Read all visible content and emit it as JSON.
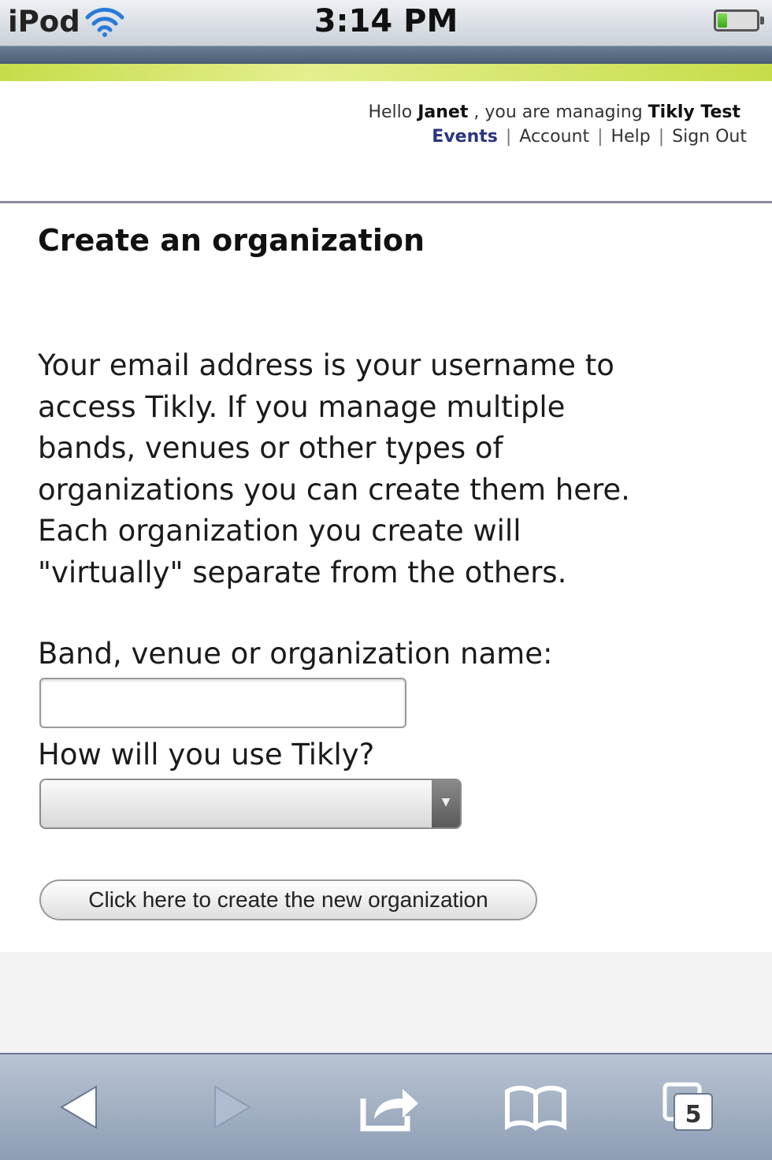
{
  "status_bar": {
    "carrier": "iPod",
    "time": "3:14 PM"
  },
  "header": {
    "greeting_prefix": "Hello",
    "user_name": "Janet",
    "greeting_middle": ", you are managing",
    "org_name": "Tikly Test",
    "nav": [
      {
        "label": "Events",
        "active": true
      },
      {
        "label": "Account",
        "active": false
      },
      {
        "label": "Help",
        "active": false
      },
      {
        "label": "Sign Out",
        "active": false
      }
    ],
    "separator": "|"
  },
  "main": {
    "title": "Create an organization",
    "intro_lines": [
      "Your email address is your username to",
      "access Tikly. If you manage multiple",
      "bands, venues or other types of",
      "organizations you can create them here.",
      "Each organization you create will",
      "\"virtually\" separate from the others."
    ],
    "name_label": "Band, venue or organization name:",
    "name_value": "",
    "usage_label": "How will you use Tikly?",
    "usage_selected": "",
    "submit_label": "Click here to create the new organization"
  },
  "toolbar": {
    "tabs_count": "5",
    "icons": [
      "back-icon",
      "forward-icon",
      "share-icon",
      "bookmarks-icon",
      "tabs-icon"
    ]
  },
  "colors": {
    "nav_active": "#2b3580",
    "header_band": "#c8dc4a",
    "toolbar": "#a3b0c3"
  }
}
